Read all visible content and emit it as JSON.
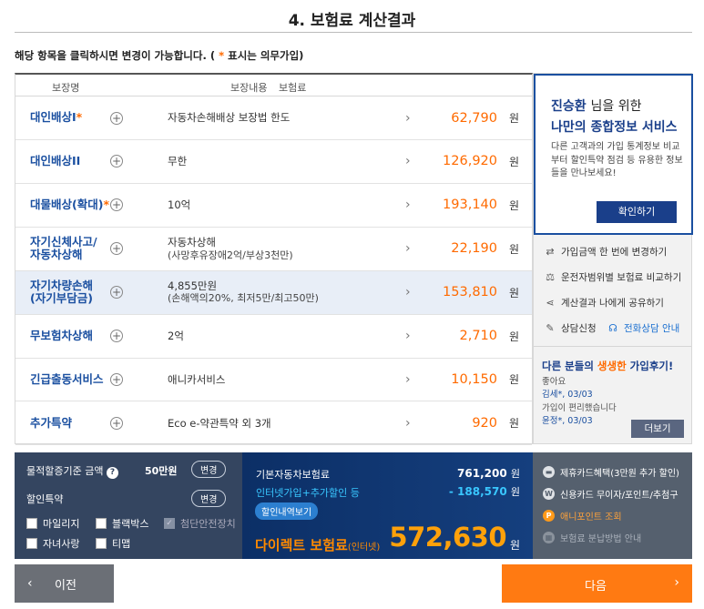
{
  "page_title": "4. 보험료 계산결과",
  "notice": {
    "before": "해당 항목을 클릭하시면 변경이 가능합니다. ( ",
    "star": "*",
    "after": " 표시는 의무가입)"
  },
  "table_header": {
    "col1": "보장명",
    "col2": "보장내용",
    "col3": "보험료"
  },
  "rows": [
    {
      "name": "대인배상I",
      "required": "*",
      "desc": "자동차손해배상 보장법 한도",
      "sub": "",
      "amount": "62,790",
      "unit": "원"
    },
    {
      "name": "대인배상II",
      "required": "",
      "desc": "무한",
      "sub": "",
      "amount": "126,920",
      "unit": "원"
    },
    {
      "name": "대물배상(확대)",
      "required": "*",
      "desc": "10억",
      "sub": "",
      "amount": "193,140",
      "unit": "원"
    },
    {
      "name": "자기신체사고/\n자동차상해",
      "required": "",
      "desc": "자동차상해",
      "sub": "(사망후유장애2억/부상3천만)",
      "amount": "22,190",
      "unit": "원"
    },
    {
      "name": "자기차량손해\n(자기부담금)",
      "required": "",
      "desc": "4,855만원",
      "sub": "(손해액의20%, 최저5만/최고50만)",
      "amount": "153,810",
      "unit": "원"
    },
    {
      "name": "무보험차상해",
      "required": "",
      "desc": "2억",
      "sub": "",
      "amount": "2,710",
      "unit": "원"
    },
    {
      "name": "긴급출동서비스",
      "required": "",
      "desc": "애니카서비스",
      "sub": "",
      "amount": "10,150",
      "unit": "원"
    },
    {
      "name": "추가특약",
      "required": "",
      "desc": "Eco e-약관특약 외 3개",
      "sub": "",
      "amount": "920",
      "unit": "원"
    }
  ],
  "side": {
    "user_name": "진승환",
    "nim_text": "님을 위한",
    "service_title": "나만의 종합정보 서비스",
    "service_desc": "다른 고객과의 가입 통계정보 비교부터 할인특약 점검 등 유용한 정보들을 만나보세요!",
    "confirm_button": "확인하기",
    "links": [
      "가입금액 한 번에 변경하기",
      "운전자범위별 보험료 비교하기",
      "계산결과 나에게 공유하기"
    ],
    "consult": "상담신청",
    "phone_consult": "전화상담 안내",
    "review_title_a": "다른 분들의 ",
    "review_title_b": "생생한",
    "review_title_c": " 가입후기!",
    "reviews": [
      {
        "text": "좋아요",
        "who": "김세*",
        "date": ", 03/03"
      },
      {
        "text": "가입이 편리했습니다",
        "who": "윤정*",
        "date": ", 03/03"
      }
    ],
    "more_button": "더보기"
  },
  "bottom_left": {
    "coverage_label": "물적할증기준 금액",
    "coverage_value": "50만원",
    "change1": "변경",
    "discount_label": "할인특약",
    "change2": "변경",
    "options": [
      "마일리지",
      "블랙박스",
      "첨단안전장치",
      "자녀사랑",
      "티맵"
    ]
  },
  "bottom_mid": {
    "base_label": "기본자동차보험료",
    "base_value": "761,200",
    "disc_label": "인터넷가입+추가할인 등",
    "disc_value": "- 188,570",
    "unit": "원",
    "detail_tag": "할인내역보기",
    "final_label": "다이렉트 보험료",
    "final_sub": "(인터넷)",
    "final_value": "572,630",
    "final_unit": "원"
  },
  "bottom_right": {
    "items": [
      "제휴카드혜택(3만원 추가 할인)",
      "신용카드 무이자/포인트/추첨구",
      "애니포인트 조회",
      "보험료 분납방법 안내"
    ]
  },
  "nav": {
    "prev": "이전",
    "next": "다음"
  },
  "colors": {
    "accent_orange": "#ff6a00",
    "navy": "#1a3f8a",
    "link_blue": "#1a4fa0"
  }
}
